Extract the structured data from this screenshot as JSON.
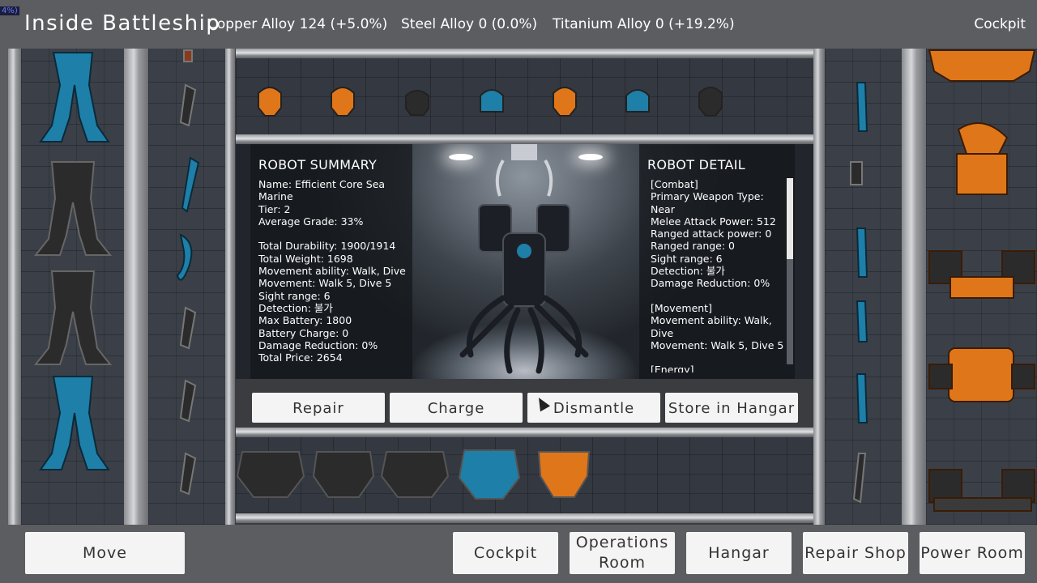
{
  "hud": {
    "debug_badge": "4%)",
    "title": "Inside Battleship",
    "resources": [
      {
        "label": "Copper Alloy 124 (+5.0%)"
      },
      {
        "label": "Steel Alloy 0 (0.0%)"
      },
      {
        "label": "Titanium Alloy 0 (+19.2%)"
      }
    ],
    "location": "Cockpit"
  },
  "summary": {
    "heading": "ROBOT SUMMARY",
    "lines": "Name: Efficient Core Sea\nMarine\nTier: 2\nAverage Grade: 33%\n\nTotal Durability: 1900/1914\nTotal Weight: 1698\nMovement ability: Walk, Dive\nMovement: Walk 5, Dive 5\nSight range: 6\nDetection: 불가\nMax Battery: 1800\nBattery Charge: 0\nDamage Reduction: 0%\nTotal Price: 2654"
  },
  "detail": {
    "heading": "ROBOT DETAIL",
    "lines": "[Combat]\nPrimary Weapon Type:\nNear\nMelee Attack Power: 512\nRanged attack power: 0\nRanged range: 0\nSight range: 6\nDetection: 불가\nDamage Reduction: 0%\n\n[Movement]\nMovement ability: Walk,\nDive\nMovement: Walk 5, Dive 5\n\n[Energy]"
  },
  "actions": {
    "repair": "Repair",
    "charge": "Charge",
    "dismantle": "Dismantle",
    "store": "Store in Hangar"
  },
  "nav": {
    "move": "Move",
    "cockpit": "Cockpit",
    "operations": "Operations Room",
    "hangar": "Hangar",
    "repair_shop": "Repair Shop",
    "power_room": "Power Room"
  },
  "colors": {
    "part_blue": "#1e7fa8",
    "part_dark": "#2b2b2b",
    "part_orange": "#e0761a"
  }
}
